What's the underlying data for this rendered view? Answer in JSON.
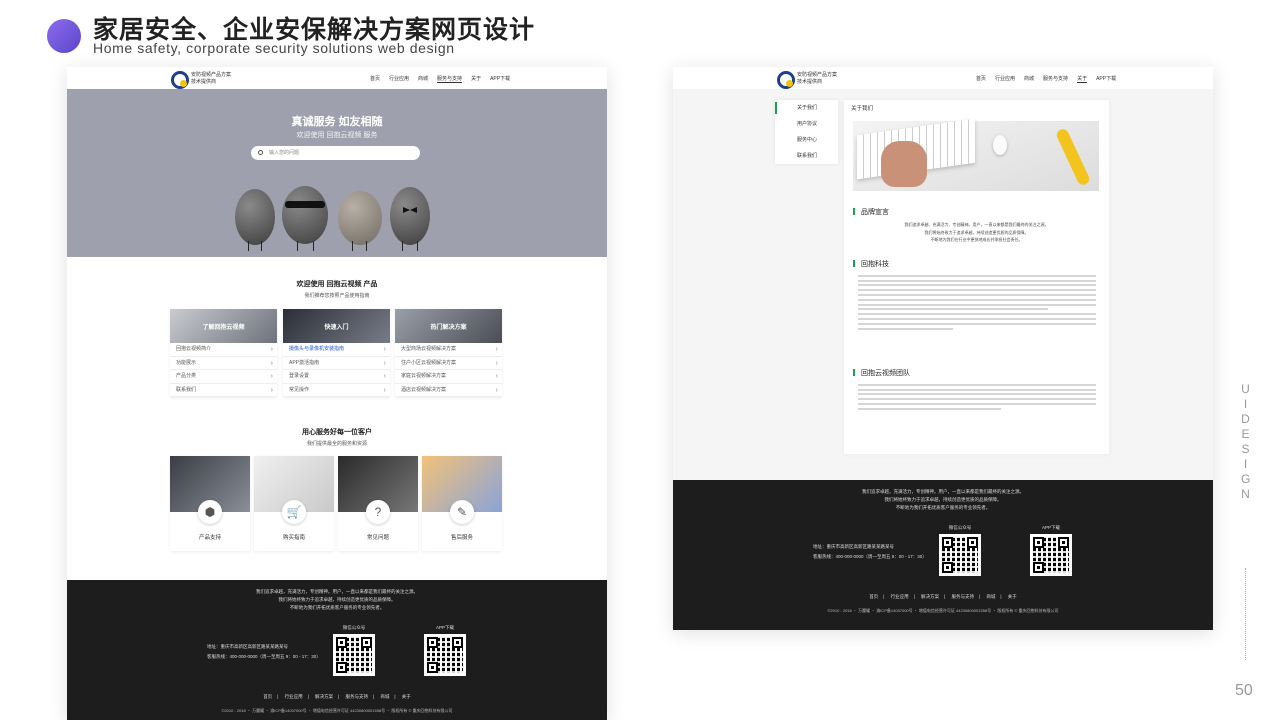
{
  "header": {
    "title_cn": "家居安全、企业安保解决方案网页设计",
    "title_en": "Home safety, corporate security solutions web design",
    "side_label": "UI DESIGN",
    "page_number": "50"
  },
  "brand": {
    "line1": "安防视频产品方案",
    "line2": "技术提供商",
    "small": "回抱科技"
  },
  "home": {
    "nav": [
      "首页",
      "行业应用",
      "商城",
      "服务与支持",
      "关于",
      "APP下载"
    ],
    "hero_title": "真诚服务 如友相随",
    "hero_subtitle": "欢迎使用 回抱云视频 服务",
    "search_placeholder": "输入您的问题",
    "welcome_title": "欢迎使用 回抱云视频 产品",
    "welcome_sub": "我们推荐您按照产品使用指南",
    "cards": [
      {
        "title": "了解回抱云视频",
        "items": [
          "回抱云视频简介",
          "功能展示",
          "产品分类",
          "联系我们"
        ]
      },
      {
        "title": "快速入门",
        "items": [
          "摄像头与录像机安装指南",
          "APP激活指南",
          "登录设置",
          "常见操作"
        ]
      },
      {
        "title": "热门解决方案",
        "items": [
          "大型商场云视频解决方案",
          "住户小区云视频解决方案",
          "家庭云视频解决方案",
          "酒店云视频解决方案"
        ]
      }
    ],
    "service_title": "用心服务好每一位客户",
    "service_sub": "我们提供最全的服务和资源",
    "tiles": [
      {
        "label": "产品支持",
        "icon": "box-icon",
        "glyph": "⬢"
      },
      {
        "label": "购买指南",
        "icon": "cart-icon",
        "glyph": "🛒"
      },
      {
        "label": "常见问题",
        "icon": "question-icon",
        "glyph": "?"
      },
      {
        "label": "售后服务",
        "icon": "wrench-icon",
        "glyph": "✎"
      }
    ]
  },
  "footer": {
    "slogan": [
      "我们追求卓越，充满活力，专创精神。用户，一直以来都是我们最终的关注之源。",
      "我们将始终致力于追求卓越，持续创造更优质的品质保障。",
      "不断地为我们开拓优质客户服务的专业领先者。"
    ],
    "address": "地址：重庆市高新区高新区路某某路某号",
    "hotline": "客服热线：400-000-0000（周一至周五 9：00 - 17：30）",
    "qr1": "微信公众号",
    "qr2": "APP下载",
    "links": [
      "首页",
      "行业应用",
      "解决方案",
      "服务与支持",
      "商城",
      "关于"
    ],
    "copyright": "©2010 - 2018 ・ 万魔耀 ・ 渝ICP备14037000号 ・ 增值电信经营许可证 44230800001558号 ・ 版权所有 © 重庆回抱科技有限公司"
  },
  "about": {
    "nav": [
      "首页",
      "行业应用",
      "商城",
      "服务与支持",
      "关于",
      "APP下载"
    ],
    "menu": [
      "关于我们",
      "用户协议",
      "服务中心",
      "联系我们"
    ],
    "content_title": "关于我们",
    "sec1": "品牌宣言",
    "sec1_text": [
      "我们追求卓越、充满活力、专创精神。用户，一直以来都是我们最终的关注之源。",
      "我们将始终致力于追求卓越，持续创造更优质的品质保障。",
      "不断地为我们在行业中更快地成长并承担社会责任。"
    ],
    "sec2": "回抱科技",
    "sec3": "回抱云视频团队"
  }
}
